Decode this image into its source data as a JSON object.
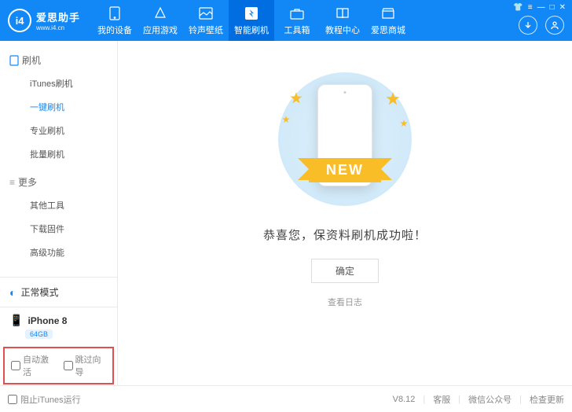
{
  "header": {
    "brand": "爱思助手",
    "url": "www.i4.cn",
    "nav": [
      {
        "label": "我的设备"
      },
      {
        "label": "应用游戏"
      },
      {
        "label": "铃声壁纸"
      },
      {
        "label": "智能刷机"
      },
      {
        "label": "工具箱"
      },
      {
        "label": "教程中心"
      },
      {
        "label": "爱思商城"
      }
    ]
  },
  "sidebar": {
    "group1": {
      "title": "刷机",
      "items": [
        "iTunes刷机",
        "一键刷机",
        "专业刷机",
        "批量刷机"
      ]
    },
    "group2": {
      "title": "更多",
      "items": [
        "其他工具",
        "下载固件",
        "高级功能"
      ]
    },
    "status": "正常模式",
    "device": {
      "name": "iPhone 8",
      "storage": "64GB"
    },
    "checks": {
      "auto_activate": "自动激活",
      "skip_guide": "跳过向导"
    }
  },
  "main": {
    "ribbon": "NEW",
    "message": "恭喜您，保资料刷机成功啦！",
    "confirm": "确定",
    "view_log": "查看日志"
  },
  "footer": {
    "block_itunes": "阻止iTunes运行",
    "version": "V8.12",
    "support": "客服",
    "wechat": "微信公众号",
    "update": "检查更新"
  }
}
